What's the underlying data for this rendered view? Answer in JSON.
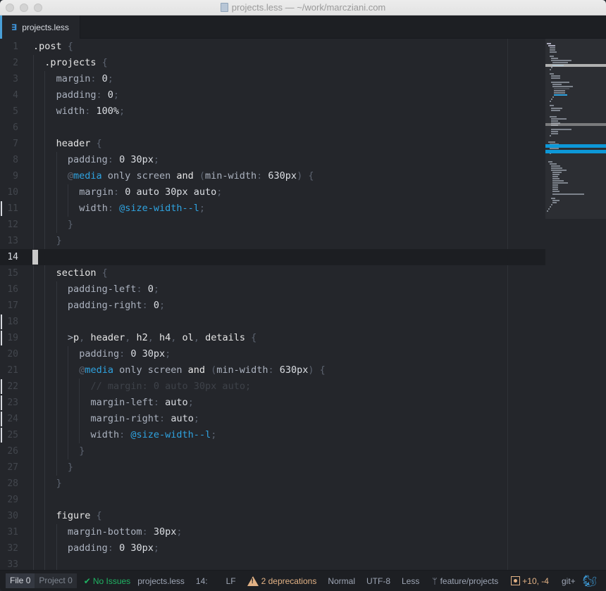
{
  "window": {
    "title": "projects.less — ~/work/marcziani.com"
  },
  "tabs": [
    {
      "label": "projects.less",
      "icon": "css3-icon",
      "active": true
    }
  ],
  "editor": {
    "cursor_line": 14,
    "lines": [
      {
        "n": "1"
      },
      {
        "n": "2"
      },
      {
        "n": "3"
      },
      {
        "n": "4"
      },
      {
        "n": "5"
      },
      {
        "n": "6"
      },
      {
        "n": "7"
      },
      {
        "n": "8"
      },
      {
        "n": "9"
      },
      {
        "n": "10"
      },
      {
        "n": "11"
      },
      {
        "n": "12"
      },
      {
        "n": "13"
      },
      {
        "n": "14"
      },
      {
        "n": "15"
      },
      {
        "n": "16"
      },
      {
        "n": "17"
      },
      {
        "n": "18"
      },
      {
        "n": "19"
      },
      {
        "n": "20"
      },
      {
        "n": "21"
      },
      {
        "n": "22"
      },
      {
        "n": "23"
      },
      {
        "n": "24"
      },
      {
        "n": "25"
      },
      {
        "n": "26"
      },
      {
        "n": "27"
      },
      {
        "n": "28"
      },
      {
        "n": "29"
      },
      {
        "n": "30"
      },
      {
        "n": "31"
      },
      {
        "n": "32"
      },
      {
        "n": "33"
      }
    ],
    "tokens": {
      "l1": [
        ".post",
        " {"
      ],
      "l2": [
        ".projects",
        " {"
      ],
      "l3": [
        "margin",
        ": ",
        "0",
        ";"
      ],
      "l4": [
        "padding",
        ": ",
        "0",
        ";"
      ],
      "l5": [
        "width",
        ": ",
        "100%",
        ";"
      ],
      "l7": [
        "header",
        " {"
      ],
      "l8": [
        "padding",
        ": ",
        "0 30px",
        ";"
      ],
      "l9": [
        "@",
        "media",
        " only screen ",
        "and",
        " (",
        "min-width",
        ": ",
        "630px",
        ") {"
      ],
      "l10": [
        "margin",
        ": ",
        "0 auto 30px auto",
        ";"
      ],
      "l11": [
        "width",
        ": ",
        "@size-width--l",
        ";"
      ],
      "l12": [
        "}"
      ],
      "l13": [
        "}"
      ],
      "l15": [
        "section",
        " {"
      ],
      "l16": [
        "padding-left",
        ": ",
        "0",
        ";"
      ],
      "l17": [
        "padding-right",
        ": ",
        "0",
        ";"
      ],
      "l19": [
        ">",
        "p",
        ", ",
        "header",
        ", ",
        "h2",
        ", ",
        "h4",
        ", ",
        "ol",
        ", ",
        "details",
        " {"
      ],
      "l20": [
        "padding",
        ": ",
        "0 30px",
        ";"
      ],
      "l21": [
        "@",
        "media",
        " only screen ",
        "and",
        " (",
        "min-width",
        ": ",
        "630px",
        ") {"
      ],
      "l22": [
        "// margin: 0 auto 30px auto;"
      ],
      "l23": [
        "margin-left",
        ": ",
        "auto",
        ";"
      ],
      "l24": [
        "margin-right",
        ": ",
        "auto",
        ";"
      ],
      "l25": [
        "width",
        ": ",
        "@size-width--l",
        ";"
      ],
      "l26": [
        "}"
      ],
      "l27": [
        "}"
      ],
      "l28": [
        "}"
      ],
      "l30": [
        "figure",
        " {"
      ],
      "l31": [
        "margin-bottom",
        ": ",
        "30px",
        ";"
      ],
      "l32": [
        "padding",
        ": ",
        "0 30px",
        ";"
      ]
    },
    "git_modified_lines": [
      11,
      18,
      19,
      22,
      23,
      24,
      25
    ]
  },
  "statusbar": {
    "linter_tabs": [
      {
        "label": "File",
        "count": "0"
      },
      {
        "label": "Project",
        "count": "0"
      }
    ],
    "linter_status": "No Issues",
    "file_name": "projects.less",
    "cursor_position": "14:",
    "line_ending": "LF",
    "deprecations": "2 deprecations",
    "mode": "Normal",
    "encoding": "UTF-8",
    "grammar": "Less",
    "branch": "feature/projects",
    "diff": "+10, -4",
    "git_plus": "git+"
  },
  "colors": {
    "accent": "#2fa3e0",
    "ok": "#1fb363",
    "warning": "#e2b285"
  }
}
